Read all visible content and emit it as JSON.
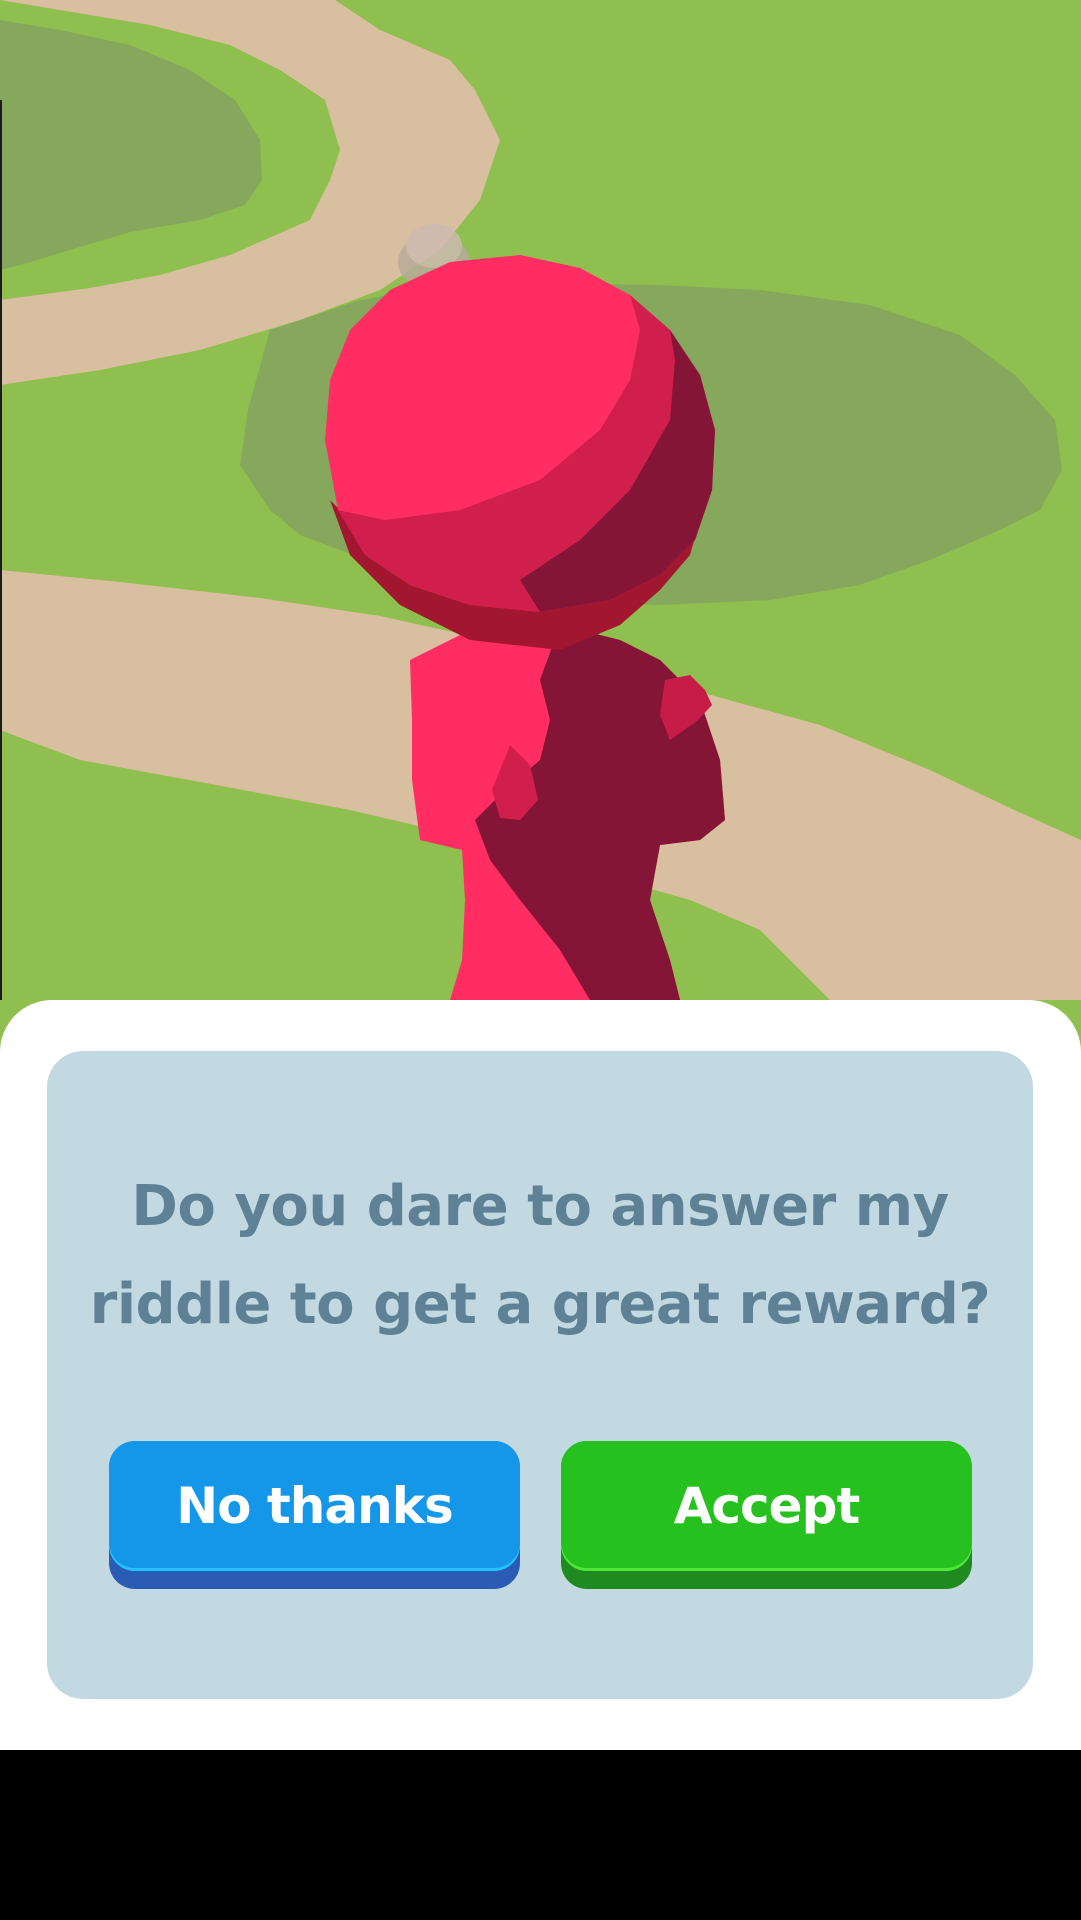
{
  "dialog": {
    "question": "Do you dare to answer my riddle to get a great reward?",
    "decline_label": "No thanks",
    "accept_label": "Accept"
  },
  "colors": {
    "grass": "#8fbf4e",
    "dark_grass": "#86a85c",
    "path": "#d8bf9f",
    "character": "#ff2d62",
    "panel": "#c3d9e1",
    "question_text": "#5f8196",
    "decline_button": "#1497e8",
    "accept_button": "#26c11e"
  }
}
